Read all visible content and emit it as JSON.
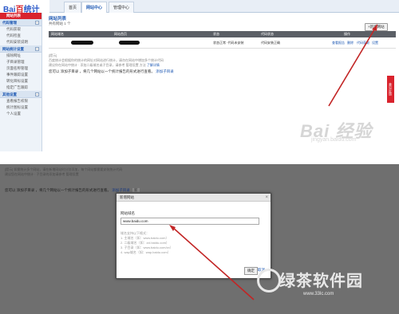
{
  "top": {
    "logo": {
      "text": "Bai",
      "paw": "百",
      "suffix": "统计"
    },
    "tabs": [
      "首页",
      "网站中心",
      "管理中心"
    ],
    "sidebar": {
      "groups": [
        {
          "title": "代码管理",
          "items": [
            "代码获取",
            "代码检查",
            "代码安装说明"
          ]
        },
        {
          "title": "网站统计设置",
          "items": [
            "排除网址",
            "子目录管理",
            "页面名称管理",
            "事件跟踪设置",
            "转化目标设置",
            "指定广告跟踪"
          ]
        },
        {
          "title": "其他设置",
          "items": [
            "查看报告权限",
            "统计图标设置",
            "个人设置"
          ]
        }
      ],
      "highlight": "网站列表"
    },
    "main": {
      "title": "网站列表",
      "subtitle": "共有网站 1 个",
      "add_button": "+新增网站",
      "columns": [
        "网站域名",
        "网站首页",
        "状态",
        "代码状态",
        "操作"
      ],
      "row": {
        "status": "状态正常 ·代码未安装",
        "code_status": "代码安装正确",
        "actions": [
          "查看报告",
          "删除",
          "代码获取",
          "设置"
        ]
      },
      "tip_lines": [
        "[提示]",
        "百度统计会根据你的统计的网址对网站进行统计，请勿在网站中增加多个统计代码",
        "建议你在网站中统计 · 添加二级域名或子目录，请参考 管理设置 方法"
      ],
      "tip_link": "了解详情",
      "tip2_text": "您可以 添加子目录 ，将几个网站以一个统计报告的形式进行查看。",
      "tip2_link": "添加子目录"
    },
    "feedback": "意见反馈",
    "watermark": "Bai 经验",
    "watermark_sub": "jingyan.baidu.com"
  },
  "bottom": {
    "faint_lines": [
      "[提示] 如需统计多个网站，请在新增网站时分别添加，每个网站都需要安装统计代码",
      "建议您在网站中统计 · 子目录的添加请参考 管理设置"
    ],
    "faint2_text": "您可以 添加子目录 ，将几个网站以一个统计报告的形式进行查看。",
    "faint2_link": "添加子目录",
    "faint2_badge": "新",
    "dialog": {
      "title": "新增网站",
      "label": "网站域名",
      "input_value": "www.baidu.com",
      "help": [
        "域名支持以下格式：",
        "1. 主域名（如：www.baidu.com）",
        "2. 二级域名（如：zxl.baidu.com）",
        "3. 子目录（如：www.baidu.com/zx）",
        "4. wap域名（如：wap.baidu.com）"
      ],
      "ok": "确定",
      "cancel": "取消"
    },
    "watermark": "绿茶软件园",
    "watermark_sub": "www.33lc.com"
  }
}
